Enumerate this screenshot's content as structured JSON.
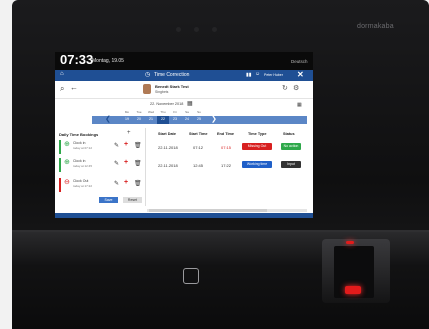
{
  "device": {
    "brand": "dormakaba"
  },
  "statusbar": {
    "time": "07:33",
    "date": "Montag, 19.05",
    "language": "Deutsch"
  },
  "app": {
    "title": "Time Correction",
    "icons": {
      "home": "home-icon",
      "clock": "clock-icon",
      "close": "close-icon"
    },
    "user_label": "Peter Huber"
  },
  "person": {
    "name": "Benedt Stark Test",
    "subtitle": "Singbeis"
  },
  "calendar": {
    "date_label": "22. November 2018",
    "weekdays": [
      "Mo",
      "Tue",
      "Wed",
      "Thu",
      "Fri",
      "Sa",
      "Su"
    ],
    "days": [
      "19",
      "20",
      "21",
      "22",
      "23",
      "24",
      "25"
    ],
    "selected_index": 3
  },
  "bookings": {
    "title": "Daily Time Bookings",
    "items": [
      {
        "label": "Clock in",
        "sub": "today at 07:12",
        "color": "#2ea84a"
      },
      {
        "label": "Clock in",
        "sub": "today at 12:45",
        "color": "#2ea84a"
      },
      {
        "label": "Clock Out",
        "sub": "today at 17:22",
        "color": "#d82020"
      }
    ],
    "save_label": "Save",
    "reset_label": "Reset"
  },
  "table": {
    "headers": [
      "Start Date",
      "Start Time",
      "End Time",
      "Time Type",
      "Status"
    ],
    "rows": [
      {
        "start_date": "22.11.2018",
        "start_time": "07:12",
        "end_time": "07:15",
        "type": "Missing Out",
        "type_color": "#d82020",
        "status": "No action",
        "status_color": "#2ea84a"
      },
      {
        "start_date": "22.11.2018",
        "start_time": "12:45",
        "end_time": "17:22",
        "type": "Working time",
        "type_color": "#1f5fc8",
        "status": "Input",
        "status_color": "#333333"
      }
    ]
  }
}
